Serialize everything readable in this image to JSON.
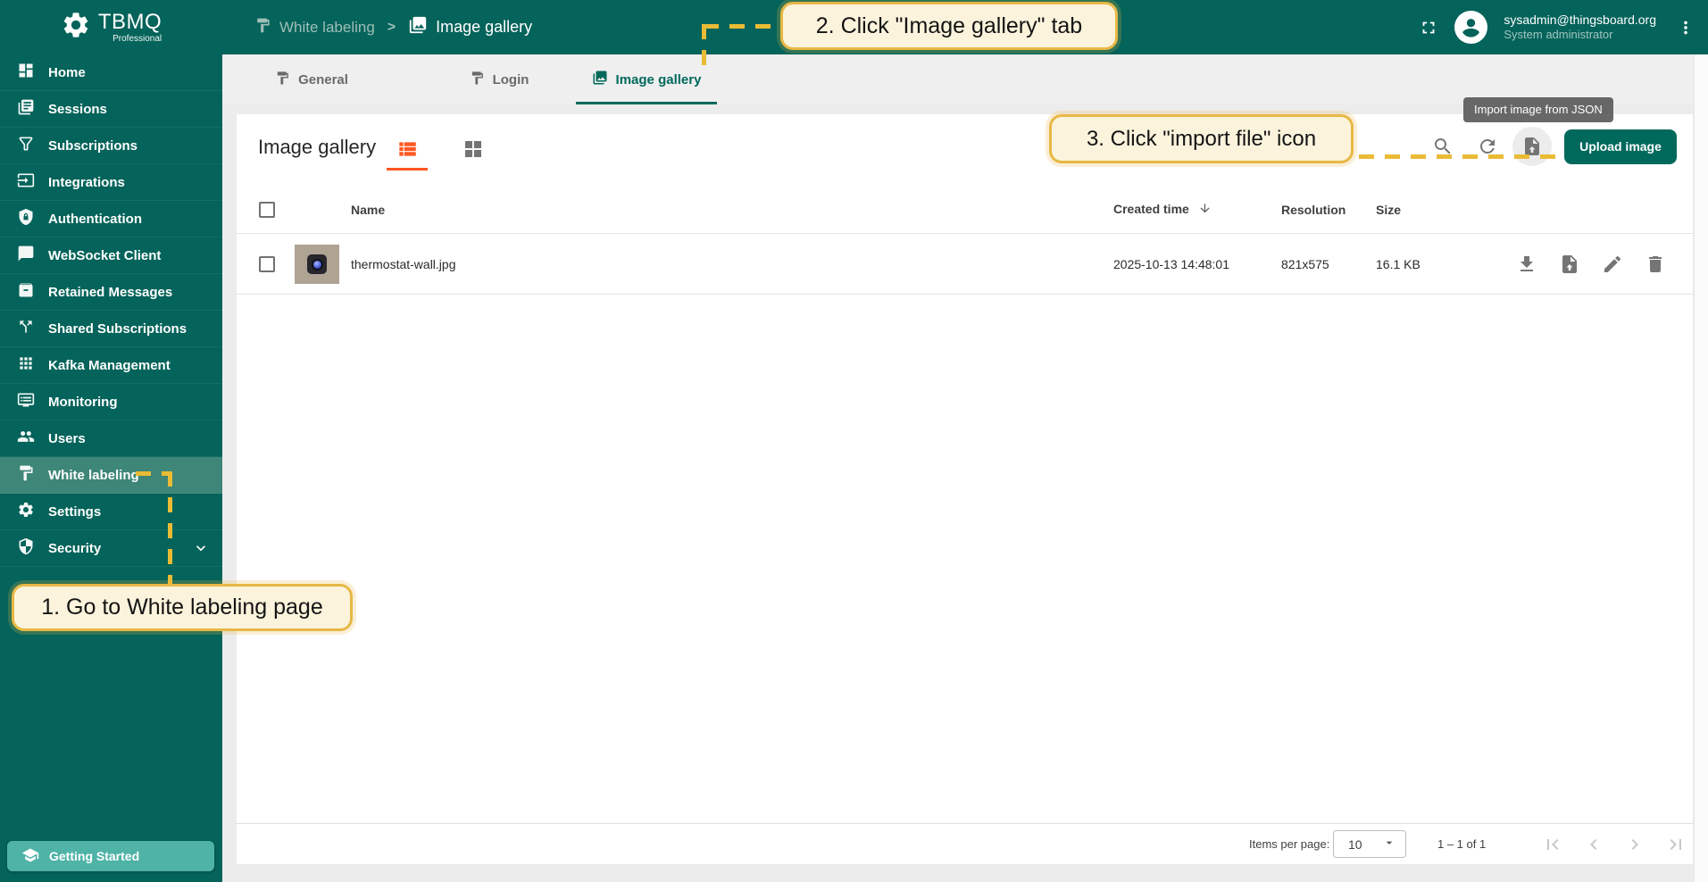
{
  "app": {
    "logo_title": "TBMQ",
    "logo_subtitle": "Professional"
  },
  "header": {
    "breadcrumb": {
      "parent": "White labeling",
      "separator": ">",
      "current": "Image gallery"
    },
    "user": {
      "email": "sysadmin@thingsboard.org",
      "role": "System administrator"
    }
  },
  "sidebar": {
    "items": [
      {
        "label": "Home",
        "icon": "dashboard-icon"
      },
      {
        "label": "Sessions",
        "icon": "sessions-icon"
      },
      {
        "label": "Subscriptions",
        "icon": "filter-icon"
      },
      {
        "label": "Integrations",
        "icon": "input-icon"
      },
      {
        "label": "Authentication",
        "icon": "shield-lock-icon"
      },
      {
        "label": "WebSocket Client",
        "icon": "chat-icon"
      },
      {
        "label": "Retained Messages",
        "icon": "archive-icon"
      },
      {
        "label": "Shared Subscriptions",
        "icon": "split-icon"
      },
      {
        "label": "Kafka Management",
        "icon": "apps-icon"
      },
      {
        "label": "Monitoring",
        "icon": "monitor-icon"
      },
      {
        "label": "Users",
        "icon": "people-icon"
      },
      {
        "label": "White labeling",
        "icon": "paint-roller-icon",
        "active": true
      },
      {
        "label": "Settings",
        "icon": "gear-icon"
      },
      {
        "label": "Security",
        "icon": "shield-icon",
        "expandable": true
      }
    ],
    "getting_started": "Getting Started"
  },
  "tabs": [
    {
      "label": "General"
    },
    {
      "label": "Login"
    },
    {
      "label": "Image gallery",
      "active": true
    }
  ],
  "toolbar": {
    "title": "Image gallery",
    "upload_label": "Upload image",
    "import_tooltip": "Import image from JSON"
  },
  "table": {
    "headers": {
      "name": "Name",
      "created": "Created time",
      "resolution": "Resolution",
      "size": "Size"
    },
    "rows": [
      {
        "name": "thermostat-wall.jpg",
        "created": "2025-10-13 14:48:01",
        "resolution": "821x575",
        "size": "16.1 KB"
      }
    ]
  },
  "pagination": {
    "items_per_page_label": "Items per page:",
    "page_size": "10",
    "range": "1 – 1 of 1"
  },
  "annotations": [
    {
      "text": "1. Go to White labeling page"
    },
    {
      "text": "2. Click \"Image gallery\" tab"
    },
    {
      "text": "3. Click \"import file\" icon"
    }
  ],
  "colors": {
    "brand": "#04635a",
    "accent": "#ff5722",
    "callout_border": "#e7b845",
    "callout_bg": "#fbf3dc"
  }
}
